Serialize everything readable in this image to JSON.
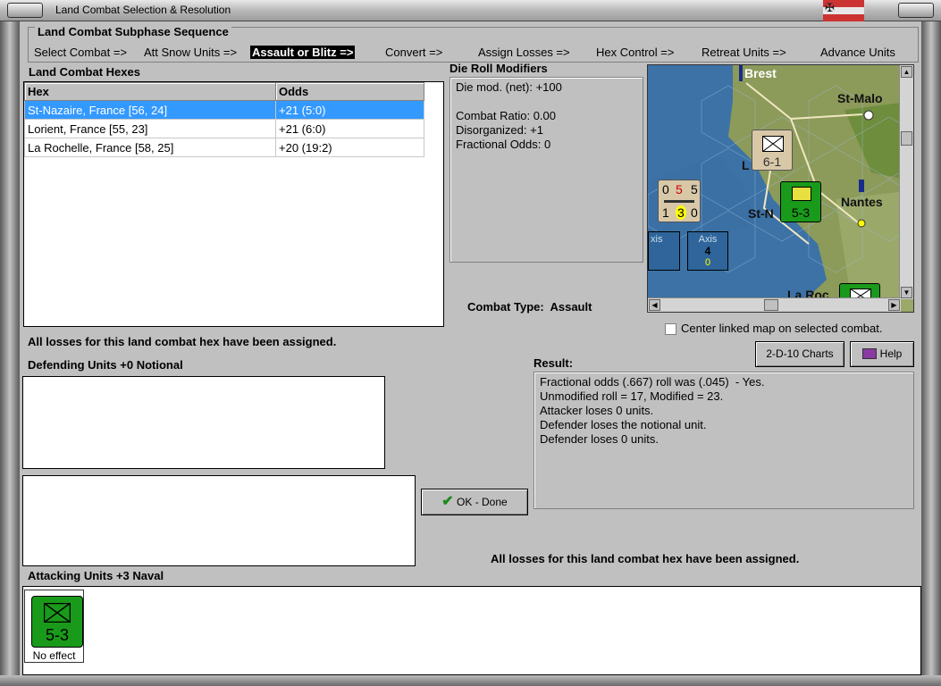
{
  "window": {
    "title": "Land Combat Selection & Resolution"
  },
  "sequence": {
    "title": "Land Combat Subphase Sequence",
    "steps": [
      "Select Combat =>",
      "Att Snow Units =>",
      "Assault or Blitz =>",
      "Convert =>",
      "Assign Losses =>",
      "Hex Control =>",
      "Retreat Units =>",
      "Advance Units"
    ],
    "active_index": 2
  },
  "hexes": {
    "title": "Land Combat Hexes",
    "columns": [
      "Hex",
      "Odds"
    ],
    "rows": [
      {
        "hex": "St-Nazaire, France [56, 24]",
        "odds": "+21 (5:0)"
      },
      {
        "hex": "Lorient, France [55, 23]",
        "odds": "+21 (6:0)"
      },
      {
        "hex": "La Rochelle, France [58, 25]",
        "odds": "+20 (19:2)"
      }
    ],
    "selected_index": 0
  },
  "modifiers": {
    "title": "Die Roll Modifiers",
    "lines": [
      "Die mod. (net): +100",
      "",
      "Combat Ratio: 0.00",
      "Disorganized: +1",
      "Fractional Odds: 0"
    ]
  },
  "combat_type": {
    "label": "Combat Type:",
    "value": "Assault"
  },
  "map": {
    "cities": [
      "Brest",
      "St-Malo",
      "Nantes",
      "St-N",
      "La Roc",
      "L"
    ],
    "axis_box": {
      "label": "Axis",
      "value": "4",
      "sub": "0"
    },
    "axis_partial": "xis",
    "units": [
      {
        "label": "6-1",
        "color": "#d8c8a8"
      },
      {
        "label": "5-3",
        "color": "#1a9a1a"
      },
      {
        "top": [
          "0",
          "5",
          "5"
        ],
        "bottom": [
          "1",
          "3",
          "0"
        ],
        "color": "#d8c8a8"
      }
    ],
    "center_checkbox_label": "Center linked map on selected combat.",
    "center_checked": false
  },
  "status_top": "All losses for this land combat hex have been assigned.",
  "defending": {
    "title": "Defending Units +0 Notional"
  },
  "buttons": {
    "charts": "2-D-10 Charts",
    "help": "Help",
    "ok": "OK - Done"
  },
  "result": {
    "title": "Result:",
    "lines": [
      "Fractional odds (.667) roll was (.045)  - Yes.",
      "Unmodified roll = 17, Modified = 23.",
      "Attacker loses 0 units.",
      "Defender loses the notional unit.",
      "Defender loses 0 units."
    ]
  },
  "status_bottom": "All losses for this land combat hex have been assigned.",
  "attacking": {
    "title": "Attacking Units +3 Naval",
    "units": [
      {
        "label": "5-3",
        "status": "No effect",
        "color": "#1a9a1a"
      }
    ]
  }
}
